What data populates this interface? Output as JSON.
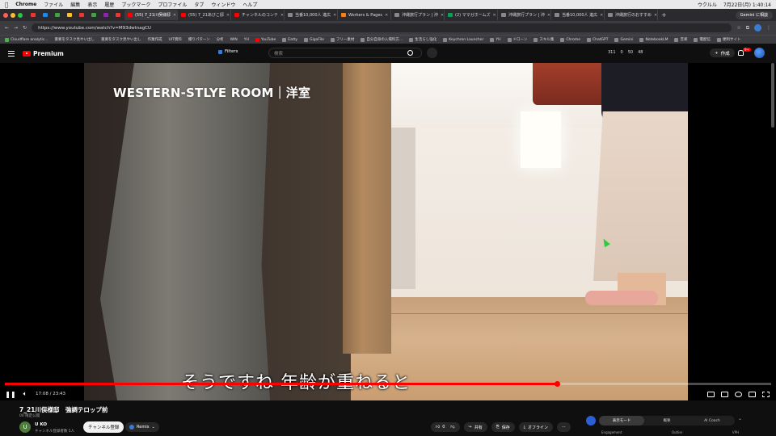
{
  "menubar": {
    "app": "Chrome",
    "items": [
      "ファイル",
      "編集",
      "表示",
      "履歴",
      "ブックマーク",
      "プロファイル",
      "タブ",
      "ウィンドウ",
      "ヘルプ"
    ],
    "clock": "7月22日(月) 1:40:14",
    "user": "ウクルル"
  },
  "tabs": [
    {
      "title": "(55) 7_21川俣様邸",
      "active": true,
      "color": "#ff0000"
    },
    {
      "title": "(55) 7_21あびこ邸",
      "active": false,
      "color": "#ff0000"
    },
    {
      "title": "チャンネルのコンテ",
      "active": false,
      "color": "#ff0000"
    },
    {
      "title": "当番10,000人 進広",
      "active": false,
      "color": "#888888"
    },
    {
      "title": "Workers & Pages",
      "active": false,
      "color": "#f38020"
    },
    {
      "title": "沖縄旅行プラン | 沖",
      "active": false,
      "color": "#888888"
    },
    {
      "title": "(2) ママガホームズ",
      "active": false,
      "color": "#0f9d58"
    },
    {
      "title": "沖縄旅行プラン | 沖",
      "active": false,
      "color": "#888888"
    },
    {
      "title": "当番10,000人 進広",
      "active": false,
      "color": "#888888"
    },
    {
      "title": "沖縄旅行のおすすめ",
      "active": false,
      "color": "#888888"
    }
  ],
  "gemini_button": "Gemini に相談",
  "address": {
    "url": "https://www.youtube.com/watch?v=M93dwtnagCU"
  },
  "bookmarks": [
    "Cloudflare analytic...",
    "重要をタスク見やい出し",
    "重要をタスク見やい出し",
    "作業作成",
    "UIT資料",
    "撮りパターン",
    "分析",
    "WIN",
    "YH",
    "YouTube",
    "Eatty",
    "GigaFile",
    "フリー素材",
    "自分自身の入場料方...",
    "生活らし強化",
    "Keychron Launcher",
    "YH",
    "ドローン",
    "スキル集",
    "Chrome",
    "ChatGPT",
    "Gemini",
    "NotebookLM",
    "音楽",
    "電配信",
    "便利サイト"
  ],
  "youtube": {
    "brand": "Premium",
    "filters": "Filters",
    "search_placeholder": "検索",
    "stats": [
      "311",
      "0",
      "50",
      "48"
    ],
    "create": "作成",
    "notif_count": "9+"
  },
  "video": {
    "room_title": "WESTERN-STLYE ROOM｜洋室",
    "subtitle": "そうですね 年齢が重ねると",
    "time": "17:08 / 23:43",
    "progress": 0.72
  },
  "info": {
    "title": "7_21川俣様邸　強調テロップ前",
    "meta": "00 限定公開",
    "channel_initial": "U",
    "channel": "U KO",
    "subs": "チャンネル登録者数 5人",
    "subscribe": "チャンネル登録",
    "remix": "Remix",
    "like": "0",
    "share": "共有",
    "save": "保存",
    "offline": "オフライン"
  },
  "panel": {
    "tabs": [
      "表示モード",
      "概要",
      "AI Coach"
    ],
    "labels": [
      "Engagement",
      "Outlier",
      "VPH"
    ]
  }
}
